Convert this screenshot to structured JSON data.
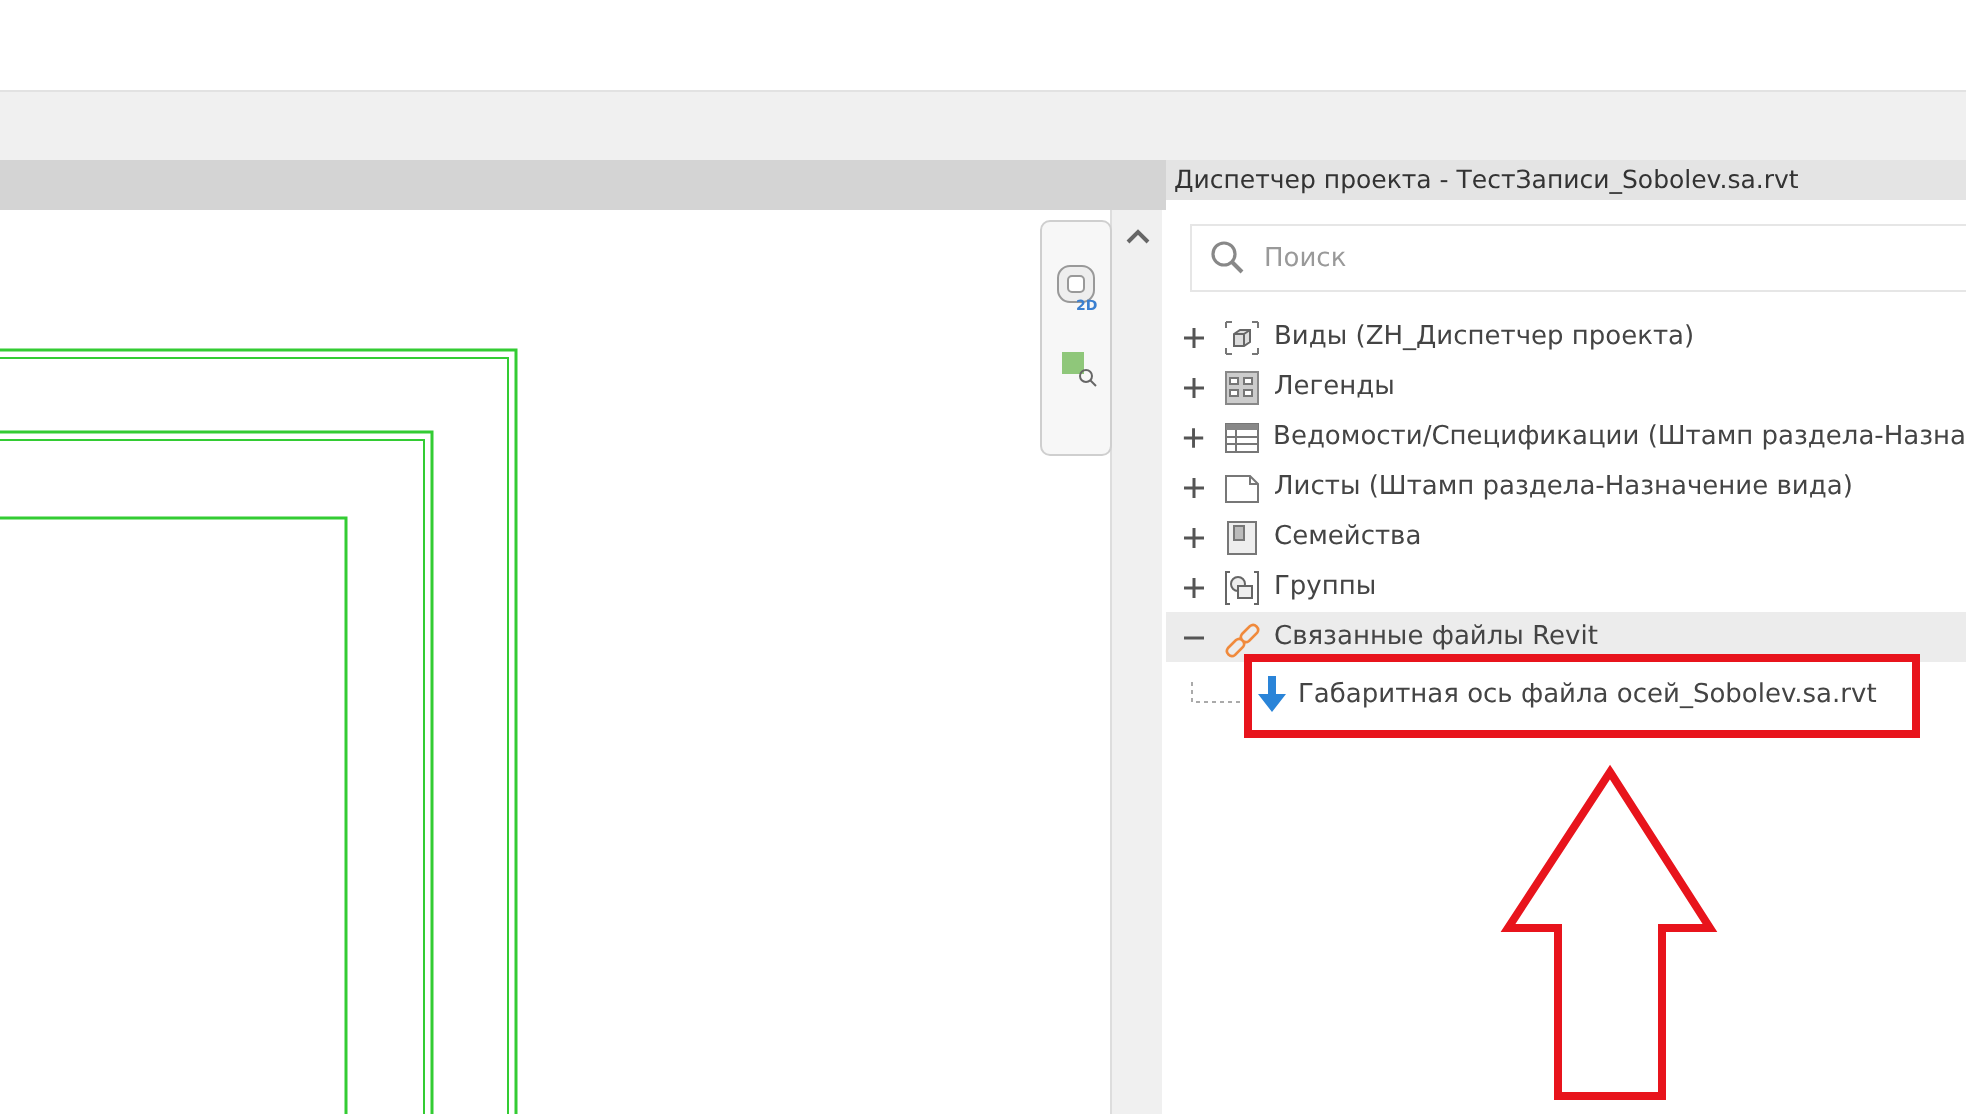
{
  "nav_bar": {
    "wheel_badge": "2D"
  },
  "project_browser": {
    "title": "Диспетчер проекта - ТестЗаписи_Sobolev.sa.rvt",
    "search": {
      "placeholder": "Поиск"
    },
    "tree": [
      {
        "label": "Виды (ZH_Диспетчер проекта)",
        "kind": "views",
        "expanded": false,
        "selected": false
      },
      {
        "label": "Легенды",
        "kind": "legends",
        "expanded": false,
        "selected": false
      },
      {
        "label": "Ведомости/Спецификации (Штамп раздела-Назна",
        "kind": "schedules",
        "expanded": false,
        "selected": false
      },
      {
        "label": "Листы (Штамп раздела-Назначение вида)",
        "kind": "sheets",
        "expanded": false,
        "selected": false
      },
      {
        "label": "Семейства",
        "kind": "families",
        "expanded": false,
        "selected": false
      },
      {
        "label": "Группы",
        "kind": "groups",
        "expanded": false,
        "selected": false
      },
      {
        "label": "Связанные файлы Revit",
        "kind": "links",
        "expanded": true,
        "selected": true,
        "children": [
          {
            "label": "Габаритная ось файла осей_Sobolev.sa.rvt",
            "kind": "linked-file",
            "selected": false
          }
        ]
      }
    ]
  }
}
